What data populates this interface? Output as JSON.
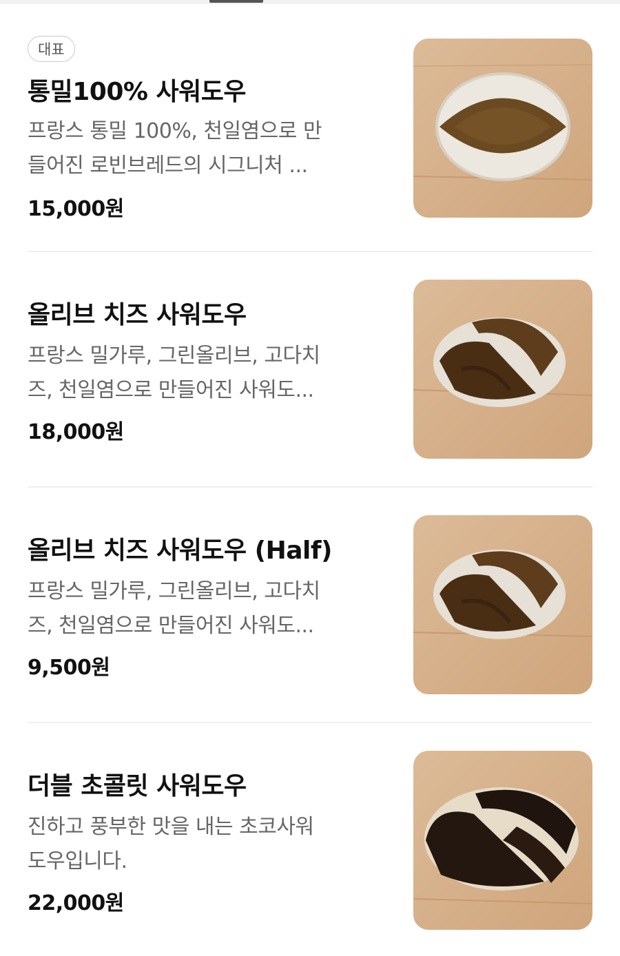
{
  "menu": {
    "items": [
      {
        "badge": "대표",
        "name": "통밀100% 사워도우",
        "desc_line1": "프랑스 통밀 100%, 천일염으로 만",
        "desc_line2": "들어진 로빈브레드의 시그니처 ...",
        "price": "15,000원",
        "image": "whole-wheat-sourdough-photo"
      },
      {
        "name": "올리브 치즈 사워도우",
        "desc_line1": "프랑스 밀가루, 그린올리브, 고다치",
        "desc_line2": "즈, 천일염으로 만들어진 사워도...",
        "price": "18,000원",
        "image": "olive-cheese-sourdough-photo"
      },
      {
        "name": "올리브 치즈 사워도우 (Half)",
        "desc_line1": "프랑스 밀가루, 그린올리브, 고다치",
        "desc_line2": "즈, 천일염으로 만들어진 사워도...",
        "price": "9,500원",
        "image": "olive-cheese-sourdough-half-photo"
      },
      {
        "name": "더블 초콜릿 사워도우",
        "desc_line1": "진하고 풍부한 맛을 내는 초코사워",
        "desc_line2": "도우입니다.",
        "price": "22,000원",
        "image": "double-chocolate-sourdough-photo"
      }
    ]
  },
  "colors": {
    "wood": "#d9b48f",
    "crust_wheat": "#6b4a22",
    "crust_dark": "#2a1a10",
    "flour": "#e8e3dc"
  }
}
